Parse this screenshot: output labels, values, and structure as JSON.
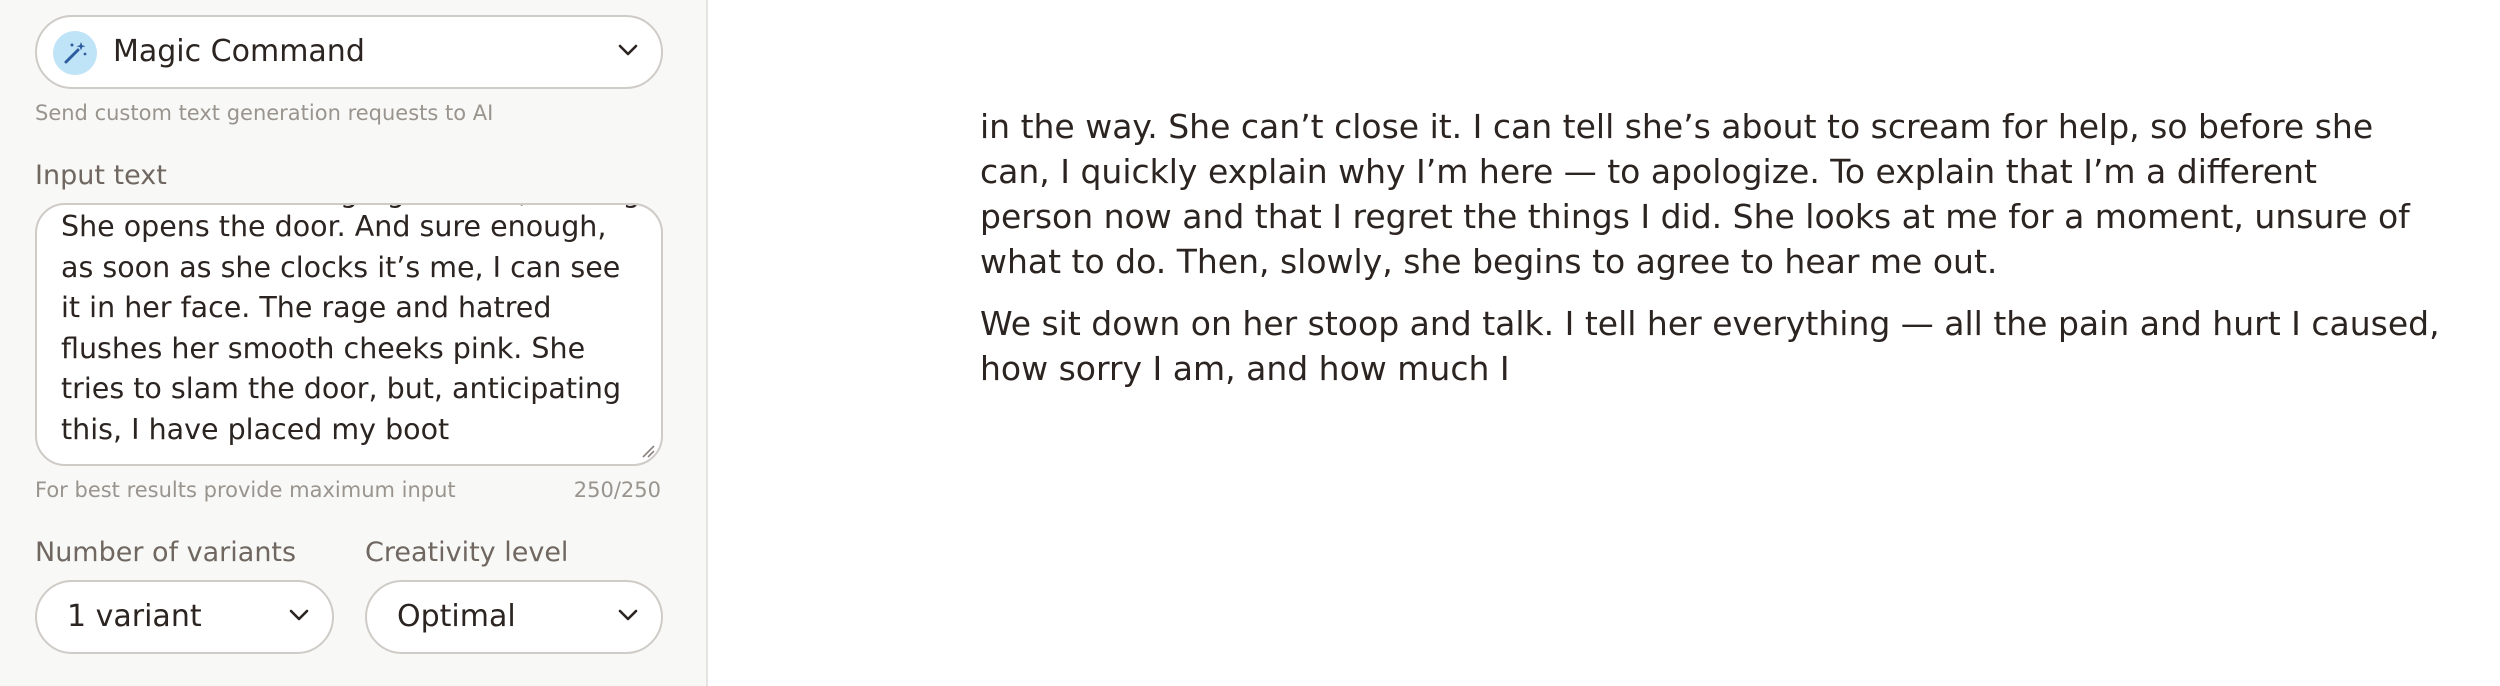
{
  "sidebar": {
    "command": {
      "label": "Magic Command",
      "description": "Send custom text generation requests to AI"
    },
    "input": {
      "label": "Input text",
      "clipped_line": "…and she's standing right there, waiting",
      "value": "She opens the door. And sure enough, as soon as she clocks it’s me, I can see it in her face. The rage and hatred flushes her smooth cheeks pink. She tries to slam the door, but, anticipating this, I have placed my boot",
      "hint": "For best results provide maximum input",
      "counter": "250/250"
    },
    "variants": {
      "label": "Number of variants",
      "selected": "1 variant"
    },
    "creativity": {
      "label": "Creativity level",
      "selected": "Optimal"
    }
  },
  "document": {
    "paragraphs": [
      "in the way. She can’t close it. I can tell she’s about to scream for help, so before she can, I quickly explain why I’m here — to apologize. To explain that I’m a different person now and that I regret the things I did. She looks at me for a moment, unsure of what to do. Then, slowly, she begins to agree to hear me out.",
      "We sit down on her stoop and talk. I tell her everything — all the pain and hurt I caused, how sorry I am, and how much I"
    ]
  },
  "icons": {
    "command": "magic-wand-icon",
    "dropdown": "chevron-down-icon",
    "resize": "resize-grip-icon"
  },
  "colors": {
    "sidebar_bg": "#f8f8f7",
    "badge_bg": "#bfe3f7",
    "text": "#2b2420",
    "muted": "#9a948e"
  }
}
